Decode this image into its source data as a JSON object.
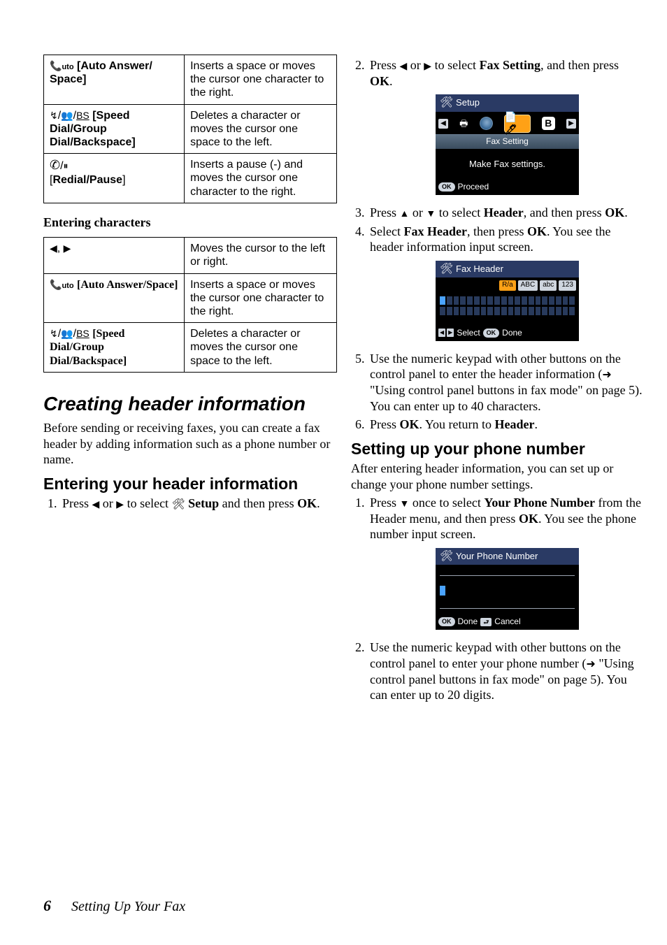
{
  "left": {
    "table1": {
      "row1": {
        "label_prefix": "",
        "label": "[Auto Answer/ Space]",
        "desc": "Inserts a space or moves the cursor one character to the right."
      },
      "row2": {
        "label_sym": "/",
        "label": "[Speed Dial/Group Dial/Backspace]",
        "desc": "Deletes a character or moves the cursor one space to the left."
      },
      "row3": {
        "label_sym": "/",
        "label": "[Redial/Pause]",
        "desc": "Inserts a pause (-) and moves the cursor one character to the right."
      }
    },
    "entering_chars_heading": "Entering characters",
    "table2": {
      "row1": {
        "label": ", ",
        "desc": "Moves the cursor to the left or right."
      },
      "row2": {
        "label": "[Auto Answer/Space]",
        "desc": "Inserts a space or moves the cursor one character to the right."
      },
      "row3": {
        "label": "[Speed Dial/Group Dial/Backspace]",
        "desc": "Deletes a character or moves the cursor one space to the left."
      }
    },
    "h2": "Creating header information",
    "para": "Before sending or receiving faxes, you can create a fax header by adding information such as a phone number or name.",
    "h3": "Entering your header information",
    "step1_pre": "Press ",
    "step1_mid": " or ",
    "step1_post1": " to select ",
    "step1_setup": " Setup",
    "step1_post2": " and then press ",
    "step1_ok": "OK",
    "step1_end": "."
  },
  "right": {
    "step2_pre": "Press ",
    "step2_mid": " or ",
    "step2_post1": " to select ",
    "step2_fax_setting": "Fax Setting",
    "step2_post2": ", and then press ",
    "step2_ok": "OK",
    "step2_end": ".",
    "lcd1": {
      "title": "Setup",
      "cap": "Fax Setting",
      "body": "Make Fax settings.",
      "foot_label": "Proceed"
    },
    "step3_pre": "Press ",
    "step3_mid": " or ",
    "step3_post1": " to select ",
    "step3_header": "Header",
    "step3_post2": ", and then press ",
    "step3_ok": "OK",
    "step3_end": ".",
    "step4_pre": "Select ",
    "step4_fax_header": "Fax Header",
    "step4_mid": ", then press ",
    "step4_ok": "OK",
    "step4_post": ". You see the header information input screen.",
    "lcd2": {
      "title": "Fax Header",
      "pill1": "R/a",
      "pill2": "ABC",
      "pill3": "abc",
      "pill4": "123",
      "foot_select": "Select",
      "foot_done": "Done"
    },
    "step5_pre": "Use the numeric keypad with other buttons on the control panel to enter the header information (",
    "step5_ref": " \"Using control panel buttons in fax mode\" on page 5). You can enter up to 40 characters.",
    "step6_pre": "Press ",
    "step6_ok": "OK",
    "step6_mid": ". You return to ",
    "step6_header": "Header",
    "step6_end": ".",
    "h3": "Setting up your phone number",
    "para": "After entering header information, you can set up or change your phone number settings.",
    "p_step1_pre": "Press ",
    "p_step1_mid": " once to select ",
    "p_step1_ypn": "Your Phone Number",
    "p_step1_mid2": " from the Header menu, and then press ",
    "p_step1_ok": "OK",
    "p_step1_post": ". You see the phone number input screen.",
    "lcd3": {
      "title": "Your Phone Number",
      "foot_done": "Done",
      "foot_cancel": "Cancel"
    },
    "p_step2_pre": "Use the numeric keypad with other buttons on the control panel to enter your phone number (",
    "p_step2_ref": " \"Using control panel buttons in fax mode\" on page 5). You can enter up to 20 digits."
  },
  "footer": {
    "page": "6",
    "title": "Setting Up Your Fax"
  }
}
